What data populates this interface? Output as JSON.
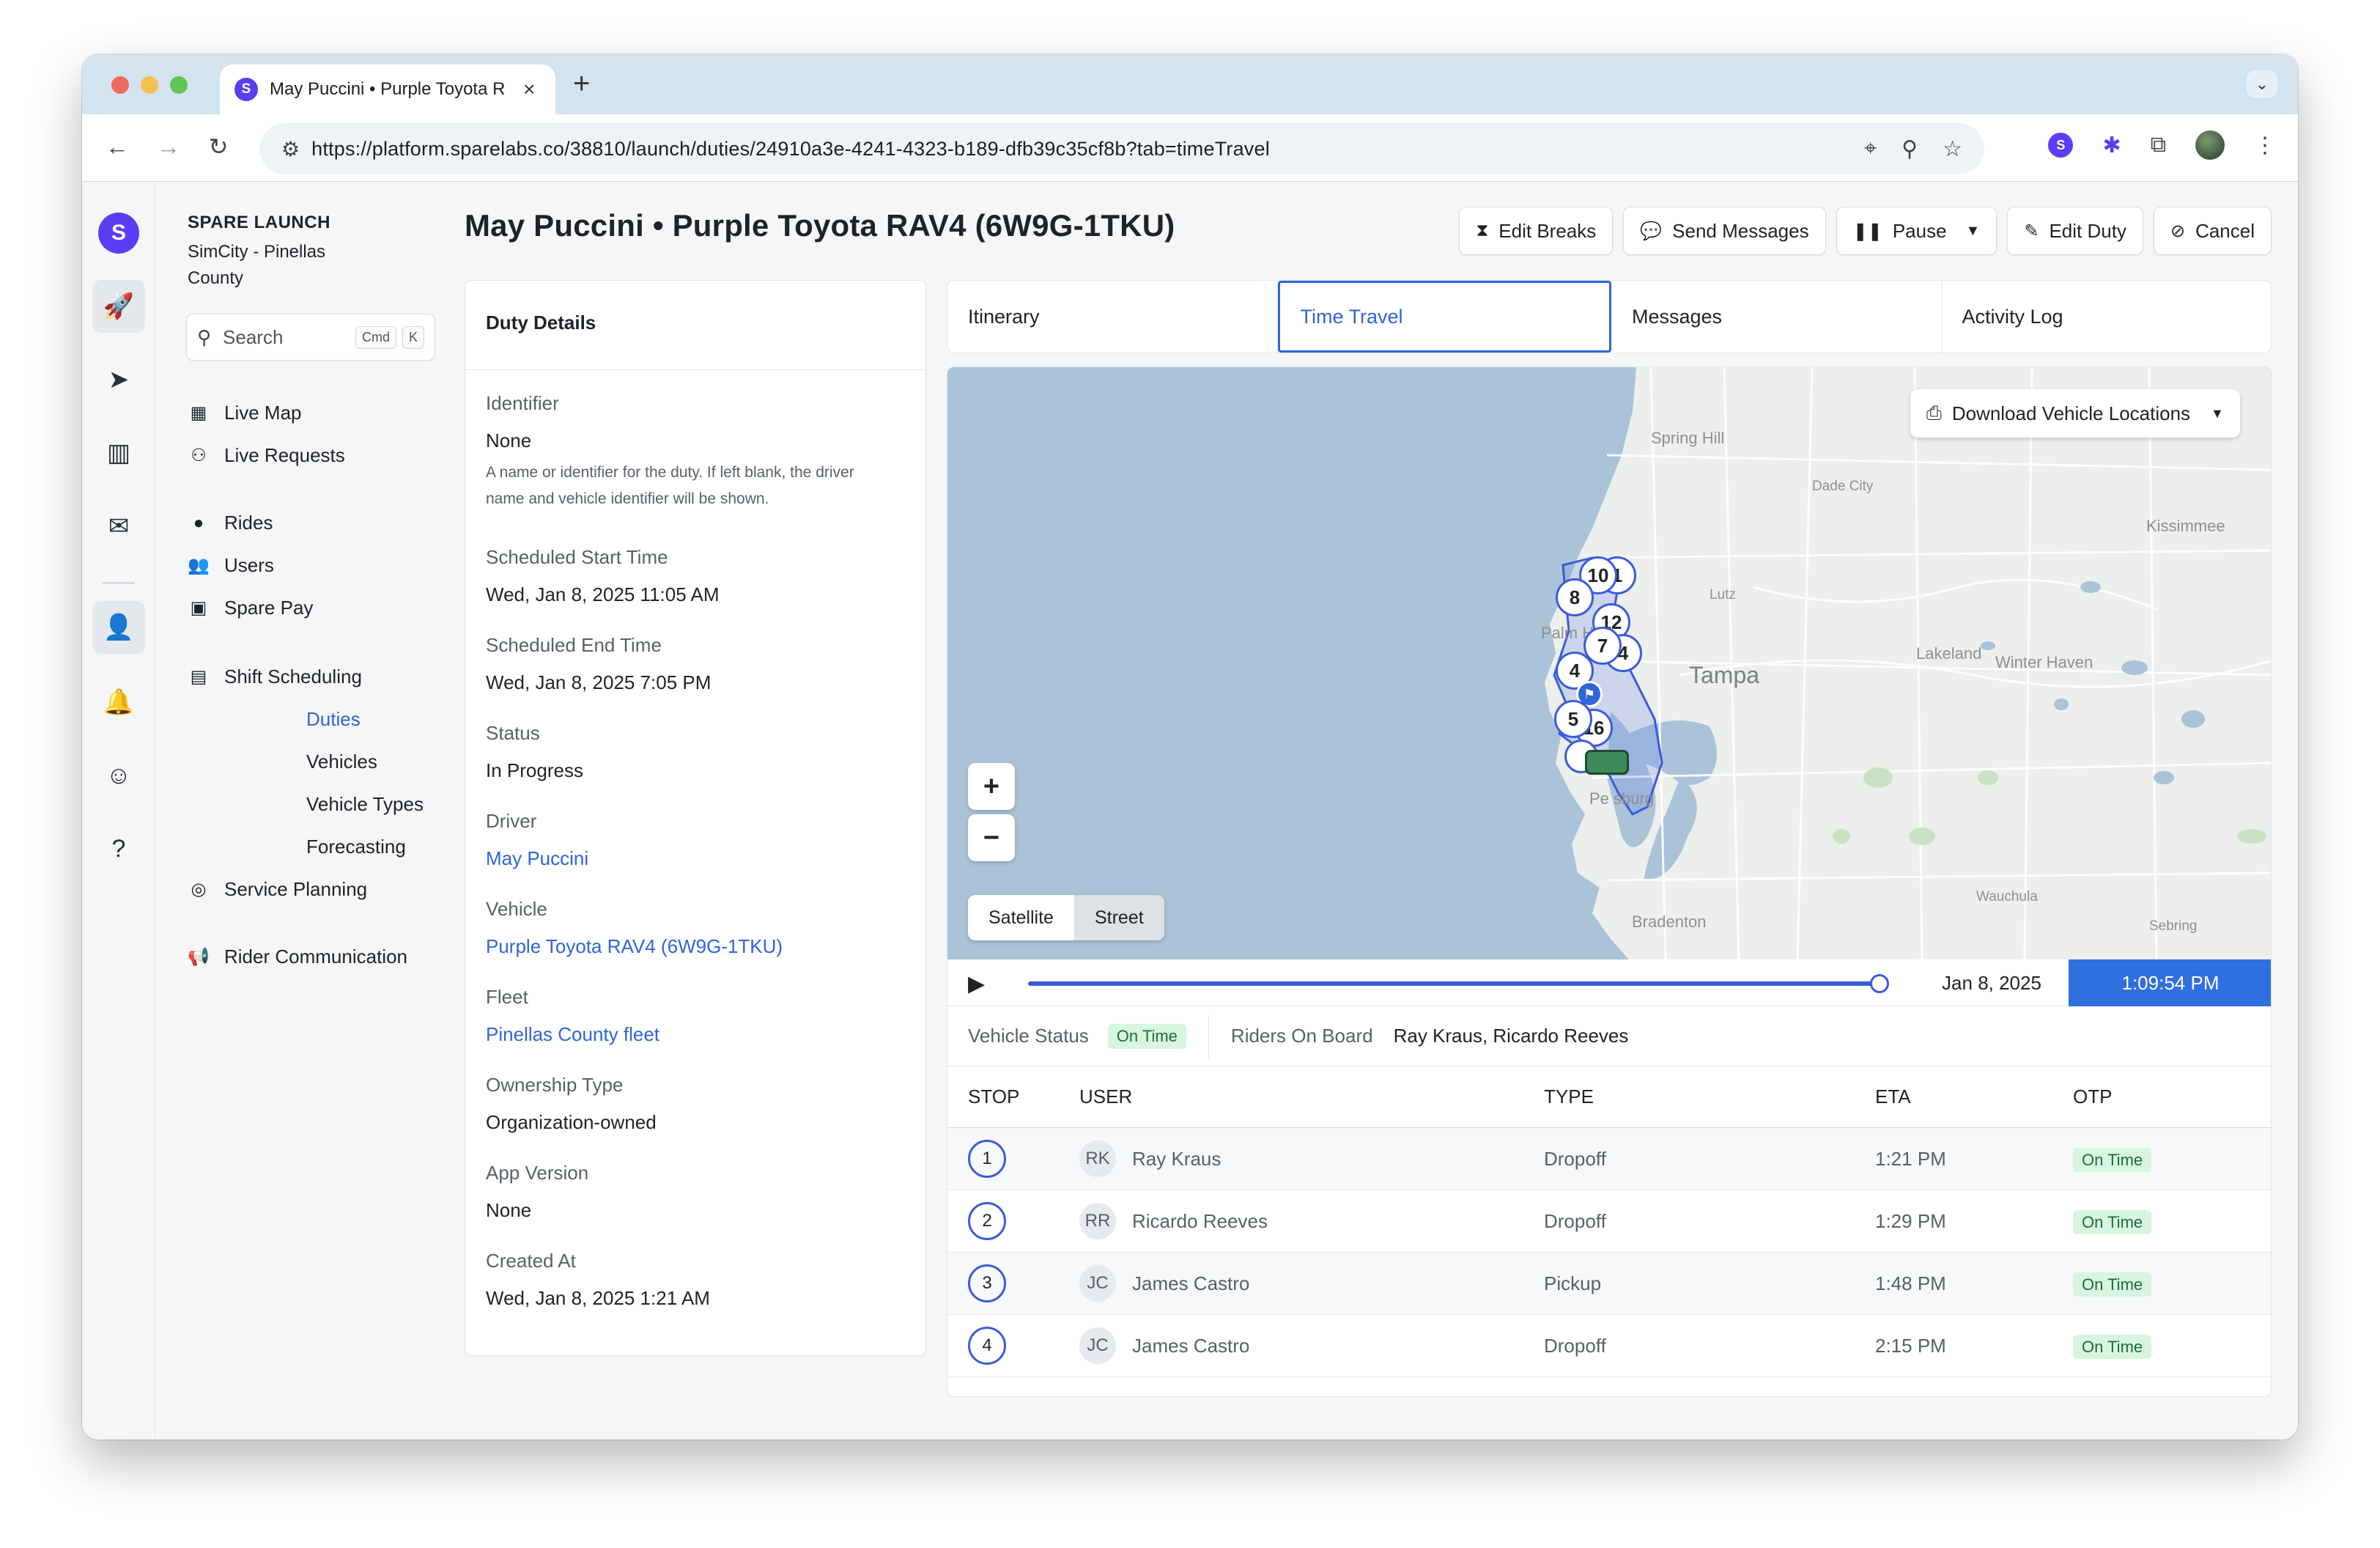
{
  "browser": {
    "tab_title": "May Puccini • Purple Toyota R",
    "favicon_letter": "S",
    "url": "https://platform.sparelabs.co/38810/launch/duties/24910a3e-4241-4323-b189-dfb39c35cf8b?tab=timeTravel",
    "extension_letter": "S"
  },
  "rail": {
    "logo_letter": "S"
  },
  "sidebar": {
    "org_title": "SPARE LAUNCH",
    "org_subtitle": "SimCity - Pinellas County",
    "search_placeholder": "Search",
    "search_kbd_1": "Cmd",
    "search_kbd_2": "K",
    "items": {
      "live_map": "Live Map",
      "live_requests": "Live Requests",
      "rides": "Rides",
      "users": "Users",
      "spare_pay": "Spare Pay",
      "shift_scheduling": "Shift Scheduling",
      "duties": "Duties",
      "vehicles": "Vehicles",
      "vehicle_types": "Vehicle Types",
      "forecasting": "Forecasting",
      "service_planning": "Service Planning",
      "rider_communication": "Rider Communication"
    }
  },
  "header": {
    "title": "May Puccini • Purple Toyota RAV4 (6W9G-1TKU)",
    "actions": {
      "edit_breaks": "Edit Breaks",
      "send_messages": "Send Messages",
      "pause": "Pause",
      "edit_duty": "Edit Duty",
      "cancel": "Cancel"
    }
  },
  "duty": {
    "heading": "Duty Details",
    "identifier_label": "Identifier",
    "identifier_value": "None",
    "identifier_help": "A name or identifier for the duty. If left blank, the driver name and vehicle identifier will be shown.",
    "start_label": "Scheduled Start Time",
    "start_value": "Wed, Jan 8, 2025 11:05 AM",
    "end_label": "Scheduled End Time",
    "end_value": "Wed, Jan 8, 2025 7:05 PM",
    "status_label": "Status",
    "status_value": "In Progress",
    "driver_label": "Driver",
    "driver_value": "May Puccini",
    "vehicle_label": "Vehicle",
    "vehicle_value": "Purple Toyota RAV4 (6W9G-1TKU)",
    "fleet_label": "Fleet",
    "fleet_value": "Pinellas County fleet",
    "ownership_label": "Ownership Type",
    "ownership_value": "Organization-owned",
    "app_version_label": "App Version",
    "app_version_value": "None",
    "created_label": "Created At",
    "created_value": "Wed, Jan 8, 2025 1:21 AM"
  },
  "tabs": {
    "itinerary": "Itinerary",
    "time_travel": "Time Travel",
    "messages": "Messages",
    "activity_log": "Activity Log"
  },
  "map": {
    "download_label": "Download Vehicle Locations",
    "zoom_in": "+",
    "zoom_out": "−",
    "satellite": "Satellite",
    "street": "Street",
    "labels": {
      "spring_hill": "Spring Hill",
      "dade_city": "Dade City",
      "kissimmee": "Kissimmee",
      "lutz": "Lutz",
      "palm_harbor": "Palm Ha",
      "tampa": "Tampa",
      "lakeland": "Lakeland",
      "winter_haven": "Winter Haven",
      "st_pete": "Pe    sburg",
      "bradenton": "Bradenton",
      "wauchula": "Wauchula",
      "sebring": "Sebring"
    },
    "pins": {
      "p10": "10",
      "p1": "1",
      "p8": "8",
      "p12": "12",
      "p7": "7",
      "p4a": "4",
      "p4": "4",
      "p5": "5",
      "p16": "16"
    }
  },
  "scrubber": {
    "progress": 1.0,
    "date": "Jan 8, 2025",
    "time": "1:09:54 PM"
  },
  "status_row": {
    "vehicle_status_label": "Vehicle Status",
    "vehicle_status_value": "On Time",
    "riders_label": "Riders On Board",
    "riders_value": "Ray Kraus, Ricardo Reeves"
  },
  "stops_table": {
    "headers": {
      "stop": "STOP",
      "user": "USER",
      "type": "TYPE",
      "eta": "ETA",
      "otp": "OTP"
    },
    "rows": [
      {
        "stop": "1",
        "initials": "RK",
        "user": "Ray Kraus",
        "type": "Dropoff",
        "eta": "1:21 PM",
        "otp": "On Time"
      },
      {
        "stop": "2",
        "initials": "RR",
        "user": "Ricardo Reeves",
        "type": "Dropoff",
        "eta": "1:29 PM",
        "otp": "On Time"
      },
      {
        "stop": "3",
        "initials": "JC",
        "user": "James Castro",
        "type": "Pickup",
        "eta": "1:48 PM",
        "otp": "On Time"
      },
      {
        "stop": "4",
        "initials": "JC",
        "user": "James Castro",
        "type": "Dropoff",
        "eta": "2:15 PM",
        "otp": "On Time"
      }
    ]
  },
  "colors": {
    "accent": "#2f65d8",
    "brand": "#5b3df5",
    "on_time_bg": "#d8f5e0",
    "water": "#aac3d8"
  }
}
